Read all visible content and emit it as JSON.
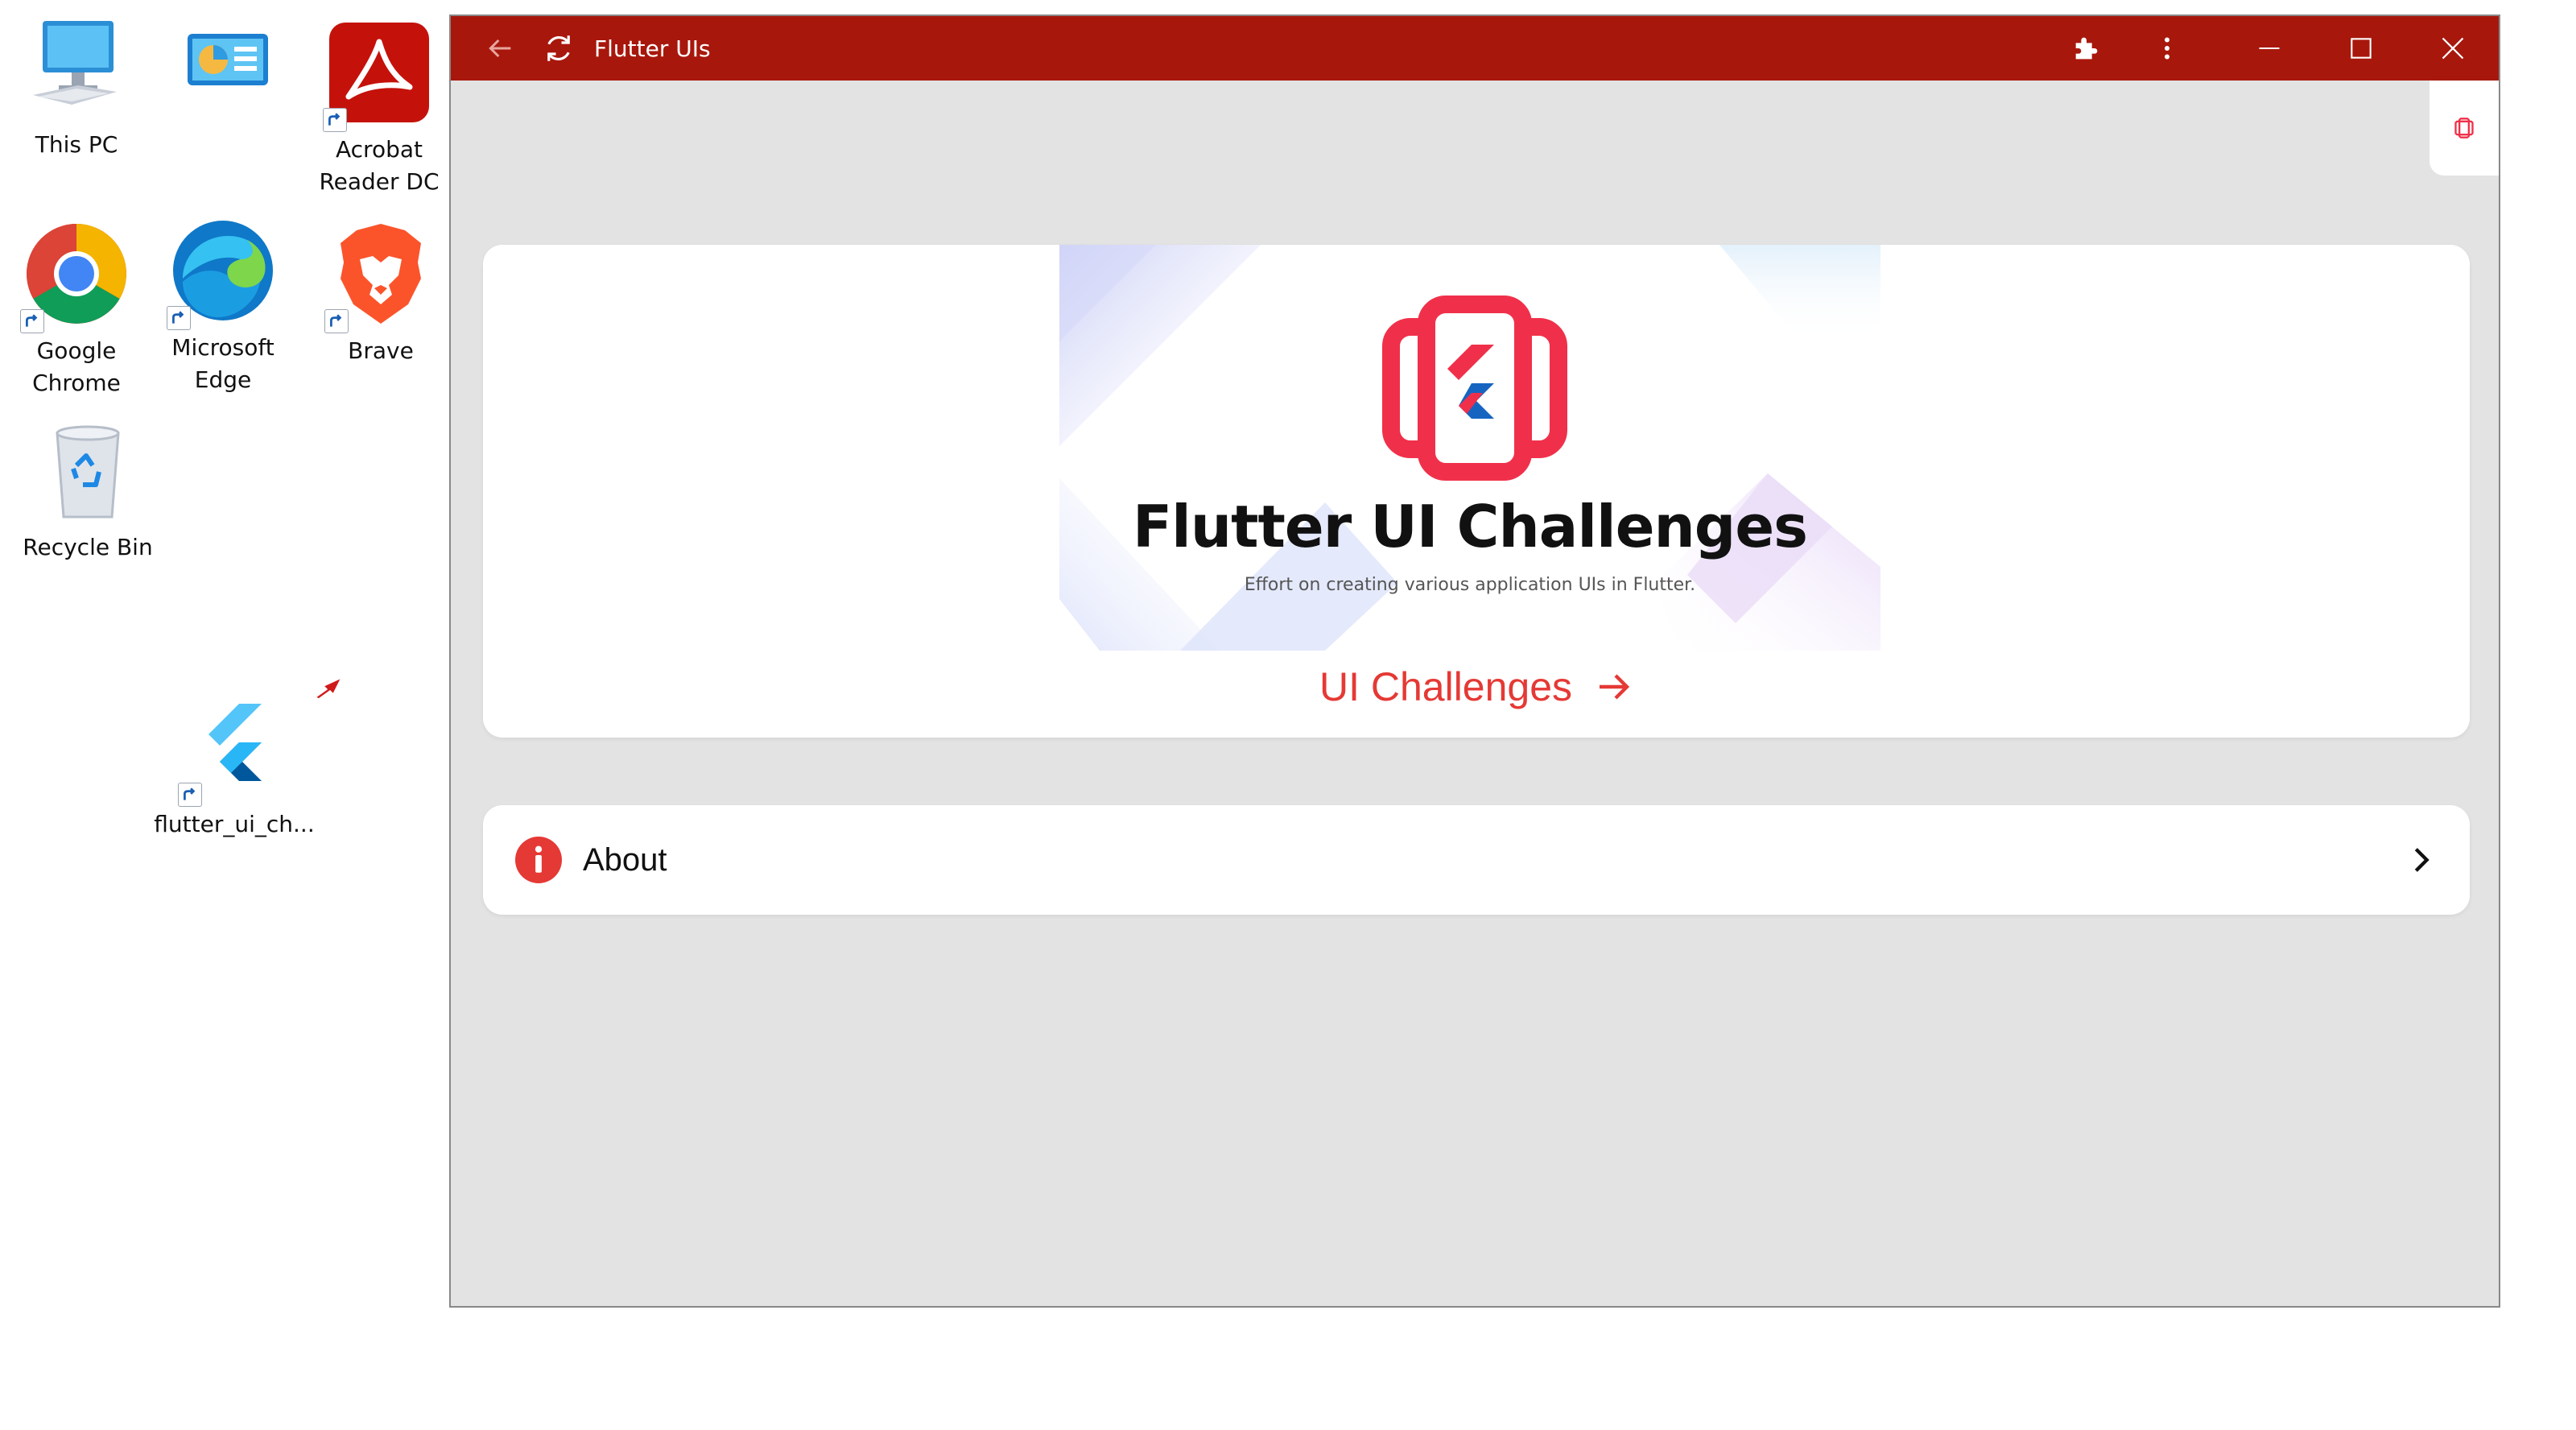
{
  "desktop": {
    "icons": [
      {
        "id": "this-pc",
        "label": "This PC"
      },
      {
        "id": "control-panel",
        "label": ""
      },
      {
        "id": "acrobat",
        "label": "Acrobat\nReader DC"
      },
      {
        "id": "chrome",
        "label": "Google\nChrome"
      },
      {
        "id": "edge",
        "label": "Microsoft\nEdge"
      },
      {
        "id": "brave",
        "label": "Brave"
      },
      {
        "id": "recycle-bin",
        "label": "Recycle Bin"
      },
      {
        "id": "flutter-shortcut",
        "label": "flutter_ui_ch..."
      }
    ]
  },
  "window": {
    "title": "Flutter UIs",
    "titlebar_color": "#a8170c",
    "content_bg": "#e3e3e3"
  },
  "hero": {
    "title": "Flutter UI Challenges",
    "subtitle": "Effort on creating various application UIs in Flutter.",
    "cta_label": "UI Challenges",
    "accent": "#e53935",
    "logo_color": "#f0304a"
  },
  "about": {
    "label": "About"
  },
  "icons": {
    "back": "arrow-left-icon",
    "refresh": "refresh-icon",
    "extensions": "puzzle-icon",
    "menu": "more-vertical-icon",
    "minimize": "minimize-icon",
    "maximize": "maximize-icon",
    "close": "close-icon",
    "cta": "arrow-right-icon",
    "about": "info-icon",
    "chevron": "chevron-right-icon"
  }
}
